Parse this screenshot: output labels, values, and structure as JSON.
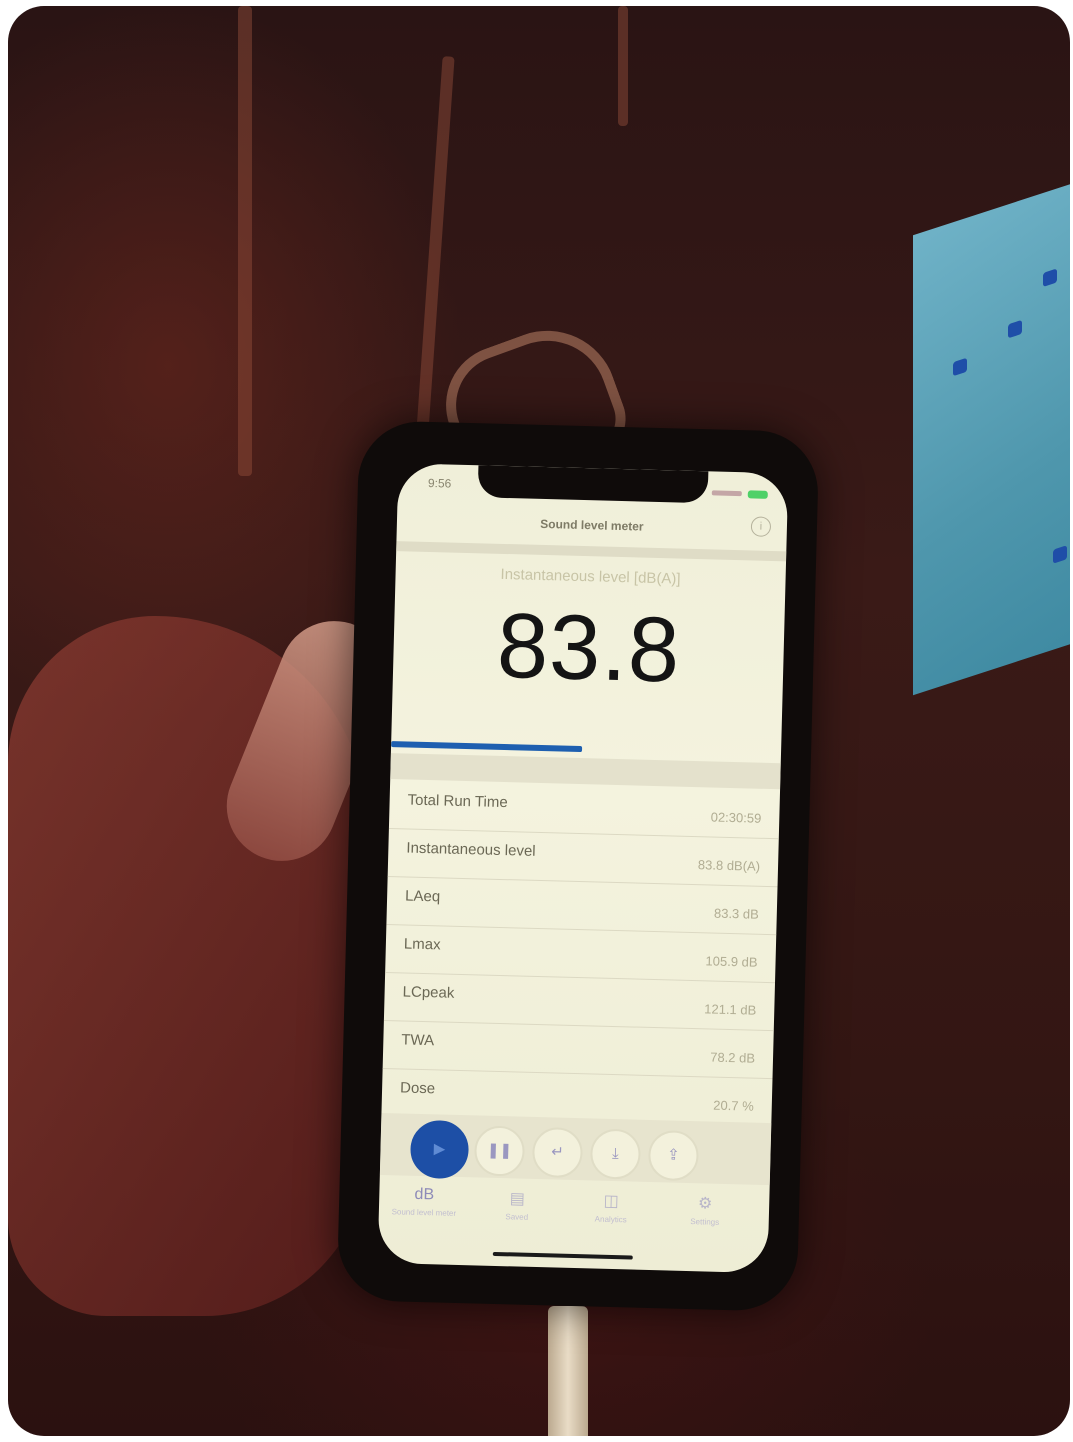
{
  "status_bar": {
    "time": "9:56"
  },
  "nav": {
    "title": "Sound level meter",
    "info_icon": "info-icon"
  },
  "meter": {
    "label": "Instantaneous level [dB(A)]",
    "value": "83.8",
    "level_fraction": 0.49,
    "accent_color": "#1e5fb0"
  },
  "rows": [
    {
      "label": "Total Run Time",
      "value": "02:30:59"
    },
    {
      "label": "Instantaneous level",
      "value": "83.8 dB(A)"
    },
    {
      "label": "LAeq",
      "value": "83.3 dB"
    },
    {
      "label": "Lmax",
      "value": "105.9 dB"
    },
    {
      "label": "LCpeak",
      "value": "121.1 dB"
    },
    {
      "label": "TWA",
      "value": "78.2 dB"
    },
    {
      "label": "Dose",
      "value": "20.7 %"
    }
  ],
  "controls": [
    {
      "name": "play-button",
      "icon": "▶"
    },
    {
      "name": "pause-button",
      "icon": "❚❚"
    },
    {
      "name": "reset-button",
      "icon": "↵"
    },
    {
      "name": "save-button",
      "icon": "⤓"
    },
    {
      "name": "share-button",
      "icon": "⇪"
    }
  ],
  "tabs": [
    {
      "icon": "dB",
      "label": "Sound level meter"
    },
    {
      "icon": "▤",
      "label": "Saved"
    },
    {
      "icon": "◫",
      "label": "Analytics"
    },
    {
      "icon": "⚙",
      "label": "Settings"
    }
  ]
}
